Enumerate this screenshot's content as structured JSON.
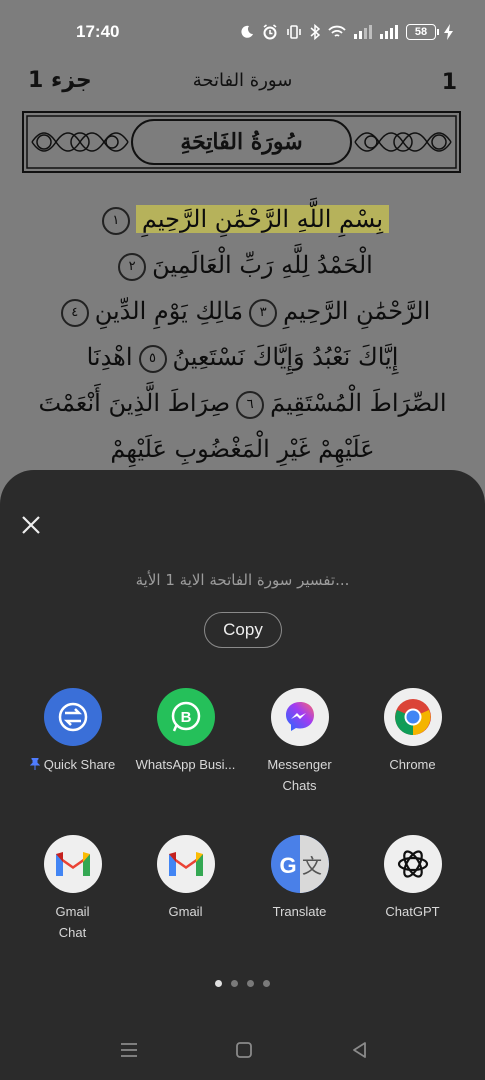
{
  "status_bar": {
    "time": "17:40",
    "battery_level": "58",
    "icons": [
      "moon-icon",
      "alarm-icon",
      "vibrate-icon",
      "bluetooth-icon",
      "wifi-icon",
      "signal-icon",
      "battery-icon",
      "charging-icon"
    ]
  },
  "quran_page": {
    "page_number": "1",
    "surah_name": "سورة الفاتحة",
    "juz_label": "جزء 1",
    "banner_title": "سُورَةُ الفَاتِحَةِ",
    "verse_lines": [
      {
        "text": "بِسْمِ اللَّهِ الرَّحْمَٰنِ الرَّحِيمِ",
        "marker": "١",
        "highlighted": true
      },
      {
        "text": "الْحَمْدُ لِلَّهِ رَبِّ الْعَالَمِينَ",
        "marker": "٢"
      },
      {
        "text": "الرَّحْمَٰنِ الرَّحِيمِ",
        "marker": "٣",
        "text2": "مَالِكِ يَوْمِ الدِّينِ",
        "marker2": "٤"
      },
      {
        "text": "إِيَّاكَ نَعْبُدُ وَإِيَّاكَ نَسْتَعِينُ",
        "marker": "٥",
        "text2": "اهْدِنَا"
      },
      {
        "text": "الصِّرَاطَ الْمُسْتَقِيمَ",
        "marker": "٦",
        "text2": "صِرَاطَ الَّذِينَ أَنْعَمْتَ"
      },
      {
        "text": "عَلَيْهِمْ غَيْرِ الْمَغْضُوبِ عَلَيْهِمْ"
      }
    ]
  },
  "share_sheet": {
    "share_text": "...تفسير سورة الفاتحة الاية 1 الأية",
    "copy_label": "Copy",
    "apps": [
      {
        "label": "Quick Share",
        "icon": "quick-share-icon",
        "color": "#3a6fd8",
        "pinned": true
      },
      {
        "label": "WhatsApp Busi...",
        "icon": "whatsapp-business-icon",
        "color": "#25c05a"
      },
      {
        "label": "Messenger Chats",
        "icon": "messenger-icon",
        "color": "#efefef"
      },
      {
        "label": "Chrome",
        "icon": "chrome-icon",
        "color": "#efefef"
      },
      {
        "label": "Gmail Chat",
        "icon": "gmail-icon",
        "color": "#efefef"
      },
      {
        "label": "Gmail",
        "icon": "gmail-icon",
        "color": "#efefef"
      },
      {
        "label": "Translate",
        "icon": "google-translate-icon",
        "color": "#4a80e8"
      },
      {
        "label": "ChatGPT",
        "icon": "chatgpt-icon",
        "color": "#efefef"
      }
    ],
    "page_indicator": {
      "pages": 4,
      "current": 1
    }
  },
  "nav_bar": {
    "buttons": [
      "menu-icon",
      "home-icon",
      "back-icon"
    ]
  }
}
